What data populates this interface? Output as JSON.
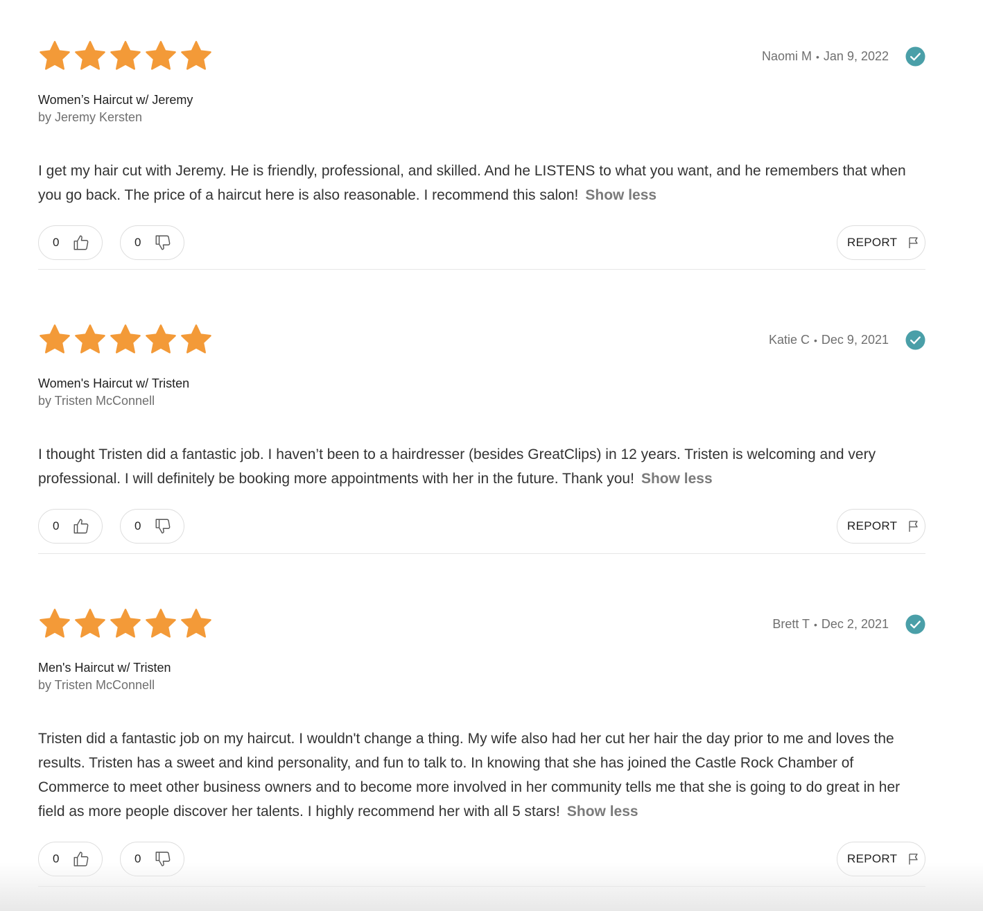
{
  "reviews": [
    {
      "rating": 5,
      "service": "Women’s Haircut w/ Jeremy",
      "stylist": "by Jeremy Kersten",
      "author": "Naomi M",
      "date": "Jan 9, 2022",
      "verified": true,
      "text": "I get my hair cut with Jeremy. He is friendly, professional, and skilled. And he LISTENS to what you want, and he remembers that when you go back. The price of a haircut here is also reasonable. I recommend this salon!",
      "toggle": "Show less",
      "helpful_count": "0",
      "unhelpful_count": "0",
      "report_label": "REPORT"
    },
    {
      "rating": 5,
      "service": "Women's Haircut w/ Tristen",
      "stylist": "by Tristen McConnell",
      "author": "Katie C",
      "date": "Dec 9, 2021",
      "verified": true,
      "text": "I thought Tristen did a fantastic job. I haven’t been to a hairdresser (besides GreatClips) in 12 years. Tristen is welcoming and very professional. I will definitely be booking more appointments with her in the future. Thank you!",
      "toggle": "Show less",
      "helpful_count": "0",
      "unhelpful_count": "0",
      "report_label": "REPORT"
    },
    {
      "rating": 5,
      "service": "Men's Haircut w/ Tristen",
      "stylist": "by Tristen McConnell",
      "author": "Brett T",
      "date": "Dec 2, 2021",
      "verified": true,
      "text": "Tristen did a fantastic job on my haircut. I wouldn't change a thing. My wife also had her cut her hair the day prior to me and loves the results. Tristen has a sweet and kind personality, and fun to talk to. In knowing that she has joined the Castle Rock Chamber of Commerce to meet other business owners and to become more involved in her community tells me that she is going to do great in her field as more people discover her talents. I highly recommend her with all 5 stars!",
      "toggle": "Show less",
      "helpful_count": "0",
      "unhelpful_count": "0",
      "report_label": "REPORT"
    }
  ],
  "meta_separator": "•",
  "colors": {
    "star": "#F39A38",
    "verified": "#4A9FA8",
    "text": "#333333",
    "muted": "#6F6F6F"
  },
  "icons": {
    "star": "star-icon",
    "verified": "verified-check-icon",
    "thumbs_up": "thumbs-up-icon",
    "thumbs_down": "thumbs-down-icon",
    "report": "flag-icon"
  }
}
